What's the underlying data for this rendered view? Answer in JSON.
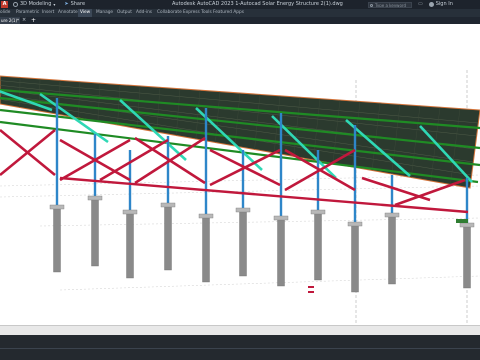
{
  "titlebar": {
    "app_icon_letter": "A",
    "workspace": "3D Modeling",
    "share_label": "Share",
    "title": "Autodesk AutoCAD 2023   1-Autocad Solar Energy Structure 2(1).dwg",
    "search_placeholder": "Type a keyword or phrase",
    "signin_label": "Sign In"
  },
  "ribbon": {
    "tabs": [
      "olide",
      "Parametric",
      "Insert",
      "Annotate",
      "View",
      "Manage",
      "Output",
      "Add-ins",
      "Collaborate",
      "Express Tools",
      "Featured Apps"
    ],
    "active_index": 4
  },
  "document_tab": {
    "label": "ure 2(1)*"
  },
  "colors": {
    "titlebar": "#1d232c",
    "ribbon": "#27303a",
    "active_tab": "#3c4857",
    "canvas": "#ffffff",
    "panel": "#2b3a2e",
    "rail": "#1f8b24",
    "rafter": "#2fd8b5",
    "post": "#2e86c9",
    "brace": "#c0183c",
    "pile": "#8a8a8a",
    "edge": "#d4743a"
  }
}
